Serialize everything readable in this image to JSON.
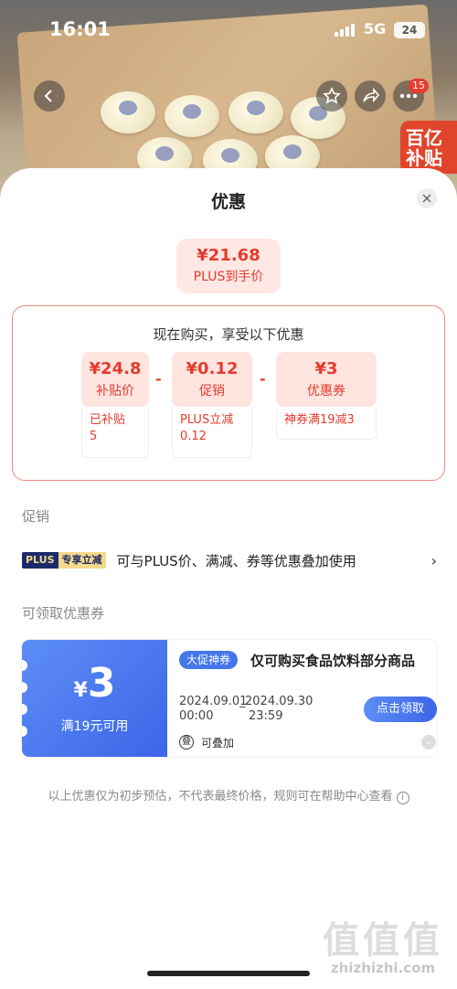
{
  "status_bar": {
    "time": "16:01",
    "network": "5G",
    "battery": "24"
  },
  "top_nav": {
    "notification_count": "15"
  },
  "product_badge": {
    "text": "百亿补贴"
  },
  "sheet": {
    "title": "优惠",
    "final_price": {
      "value": "¥21.68",
      "label": "PLUS到手价"
    },
    "summary": {
      "heading": "现在购买，享受以下优惠",
      "items": [
        {
          "value": "¥24.8",
          "label": "补贴价",
          "note": "已补贴\n5"
        },
        {
          "value": "¥0.12",
          "label": "促销",
          "note": "PLUS立减\n0.12"
        },
        {
          "value": "¥3",
          "label": "优惠券",
          "note": "神券满19减3"
        }
      ],
      "operators": [
        "-",
        "-"
      ]
    },
    "promotion": {
      "section_title": "促销",
      "tag_a": "PLUS",
      "tag_b": "专享立减",
      "text": "可与PLUS价、满减、券等优惠叠加使用",
      "arrow": "›"
    },
    "coupons": {
      "section_title": "可领取优惠券",
      "items": [
        {
          "symbol": "¥",
          "amount": "3",
          "condition": "满19元可用",
          "tag": "大促神券",
          "title": "仅可购买食品饮料部分商品",
          "start_date": "2024.09.01",
          "start_time": "00:00",
          "end_date": "2024.09.30",
          "end_time": "23:59",
          "button": "点击领取",
          "stack_label": "可叠加"
        }
      ]
    },
    "disclaimer": "以上优惠仅为初步预估，不代表最终价格，规则可在帮助中心查看"
  },
  "watermark": {
    "glyphs": "值值值",
    "url": "zhizhizhi.com"
  }
}
